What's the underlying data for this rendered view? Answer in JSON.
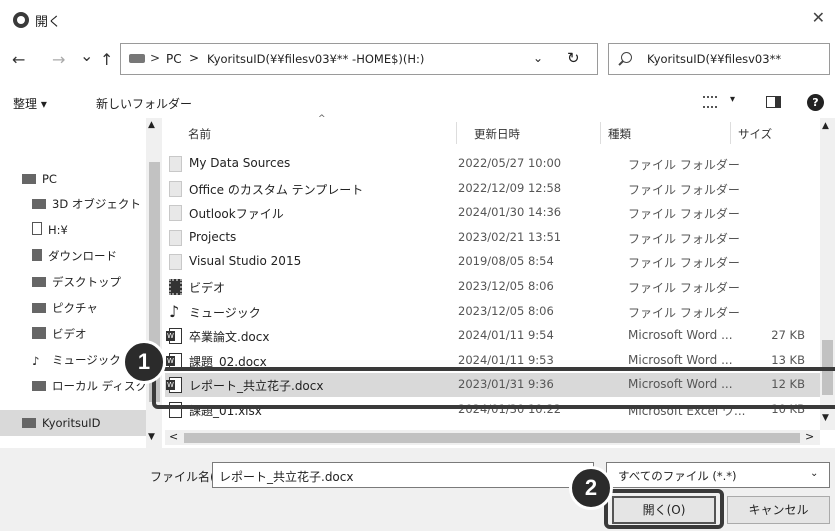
{
  "window": {
    "title": "開く",
    "close_glyph": "✕"
  },
  "nav": {
    "back": "←",
    "forward": "→",
    "recent": "⌄",
    "up": "↑",
    "address_sep": ">",
    "address_pc": "PC",
    "address_path": "KyoritsuID(¥¥filesv03¥** -HOME$)(H:)",
    "address_chevron": "⌄",
    "refresh": "↻",
    "search_text": "KyoritsuID(¥¥filesv03**"
  },
  "toolbar": {
    "organize": "整理 ▾",
    "new_folder": "新しいフォルダー",
    "view_chevron": "▾",
    "help": "?"
  },
  "sidebar": {
    "items": [
      {
        "label": "PC"
      },
      {
        "label": "3D オブジェクト"
      },
      {
        "label": "H:¥"
      },
      {
        "label": "ダウンロード"
      },
      {
        "label": "デスクトップ"
      },
      {
        "label": "ピクチャ"
      },
      {
        "label": "ビデオ"
      },
      {
        "label": "ミュージック"
      },
      {
        "label": "ローカル ディスク"
      },
      {
        "label": "KyoritsuID"
      }
    ]
  },
  "columns": {
    "name": "名前",
    "date": "更新日時",
    "type": "種類",
    "size": "サイズ",
    "sort_glyph": "^"
  },
  "files": [
    {
      "name": "My Data Sources",
      "date": "2022/05/27 10:00",
      "type": "ファイル フォルダー",
      "size": "",
      "icon": "folder-icon"
    },
    {
      "name": "Office のカスタム テンプレート",
      "date": "2022/12/09 12:58",
      "type": "ファイル フォルダー",
      "size": "",
      "icon": "folder-icon"
    },
    {
      "name": "Outlookファイル",
      "date": "2024/01/30 14:36",
      "type": "ファイル フォルダー",
      "size": "",
      "icon": "folder-icon"
    },
    {
      "name": "Projects",
      "date": "2023/02/21 13:51",
      "type": "ファイル フォルダー",
      "size": "",
      "icon": "folder-icon"
    },
    {
      "name": "Visual Studio 2015",
      "date": "2019/08/05 8:54",
      "type": "ファイル フォルダー",
      "size": "",
      "icon": "folder-icon"
    },
    {
      "name": "ビデオ",
      "date": "2023/12/05 8:06",
      "type": "ファイル フォルダー",
      "size": "",
      "icon": "video-icon"
    },
    {
      "name": "ミュージック",
      "date": "2023/12/05 8:06",
      "type": "ファイル フォルダー",
      "size": "",
      "icon": "music-icon"
    },
    {
      "name": "卒業論文.docx",
      "date": "2024/01/11 9:54",
      "type": "Microsoft Word ...",
      "size": "27 KB",
      "icon": "word-icon"
    },
    {
      "name": "課題_02.docx",
      "date": "2024/01/11 9:53",
      "type": "Microsoft Word ...",
      "size": "13 KB",
      "icon": "word-icon"
    },
    {
      "name": "レポート_共立花子.docx",
      "date": "2023/01/31 9:36",
      "type": "Microsoft Word ...",
      "size": "12 KB",
      "icon": "word-icon",
      "selected": true
    },
    {
      "name": "課題_01.xlsx",
      "date": "2024/01/30 10:22",
      "type": "Microsoft Excel ワ...",
      "size": "10 KB",
      "icon": "excel-icon"
    }
  ],
  "bottom": {
    "filename_label": "ファイル名(N):",
    "filename_value": "レポート_共立花子.docx",
    "filetype_value": "すべてのファイル (*.*)",
    "filetype_chevron": "⌄",
    "open_label": "開く(O)",
    "cancel_label": "キャンセル"
  },
  "callouts": {
    "step1": "1",
    "step2": "2"
  }
}
